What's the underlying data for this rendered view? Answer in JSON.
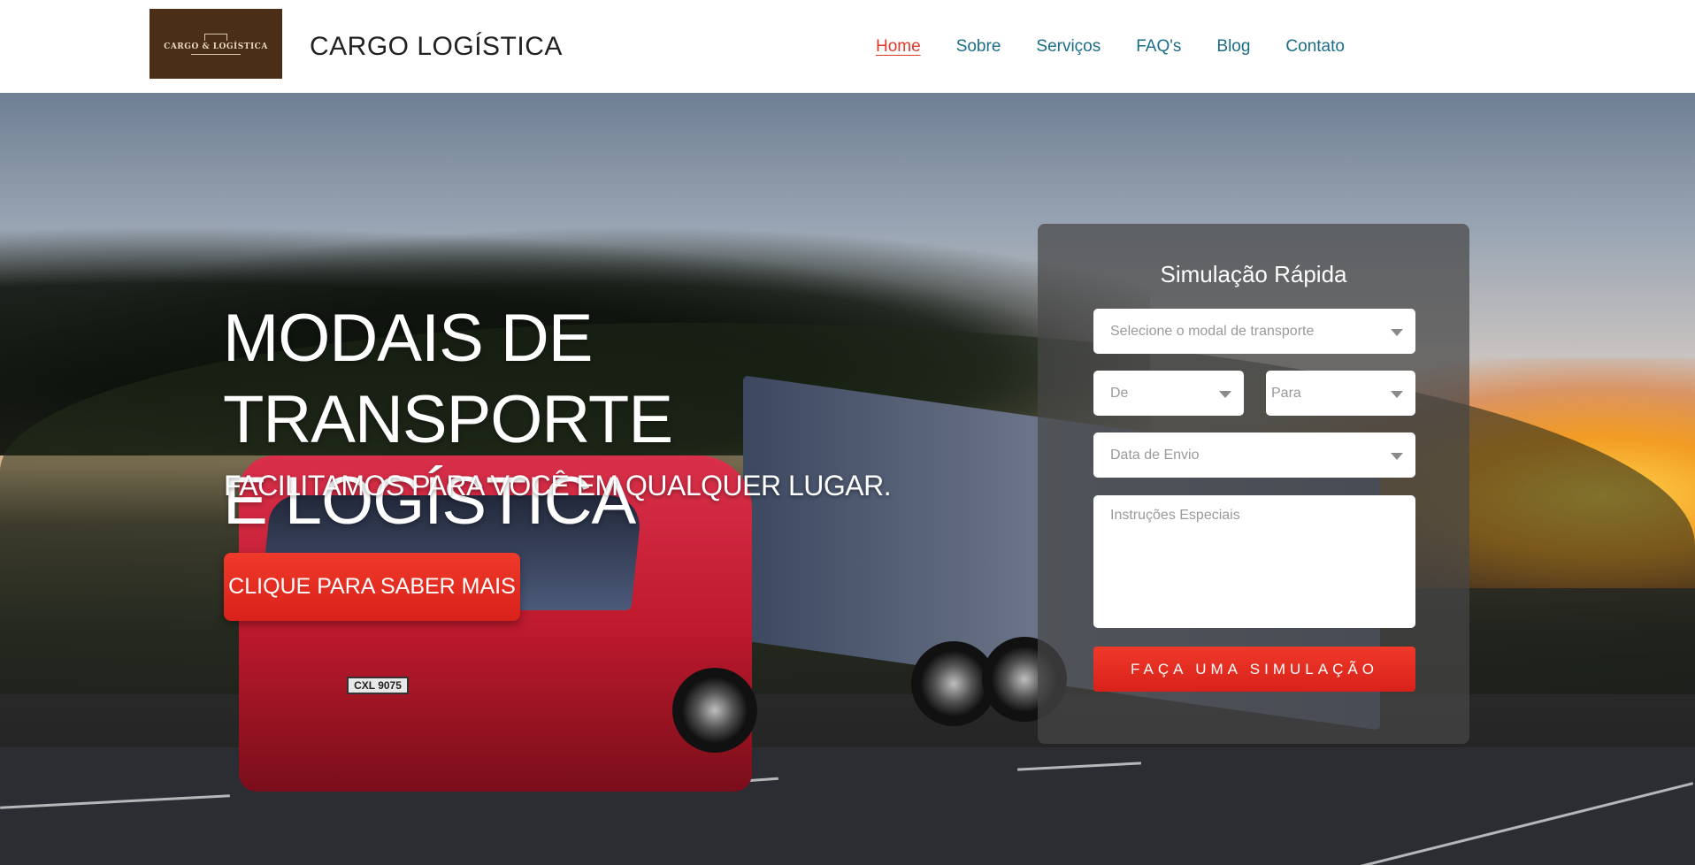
{
  "header": {
    "logo_text": "CARGO & LOGÍSTICA",
    "brand": "CARGO LOGÍSTICA",
    "nav": [
      {
        "label": "Home"
      },
      {
        "label": "Sobre"
      },
      {
        "label": "Serviços"
      },
      {
        "label": "FAQ's"
      },
      {
        "label": "Blog"
      },
      {
        "label": "Contato"
      }
    ]
  },
  "hero": {
    "title_line1": "MODAIS DE TRANSPORTE",
    "title_line2": "E LOGÍSTICA",
    "subtitle": "FACILITAMOS PARA VOCÊ EM QUALQUER LUGAR.",
    "cta_label": "CLIQUE PARA SABER MAIS",
    "truck_plate": "CXL 9075"
  },
  "form": {
    "title": "Simulação Rápida",
    "modal_placeholder": "Selecione o modal de transporte",
    "from_placeholder": "De",
    "to_placeholder": "Para",
    "date_placeholder": "Data de Envio",
    "instructions_placeholder": "Instruções Especiais",
    "submit_label": "FAÇA UMA SIMULAÇÃO"
  },
  "colors": {
    "accent": "#e03a2c",
    "nav_link": "#1b6d86",
    "logo_bg": "#4a2e18"
  }
}
